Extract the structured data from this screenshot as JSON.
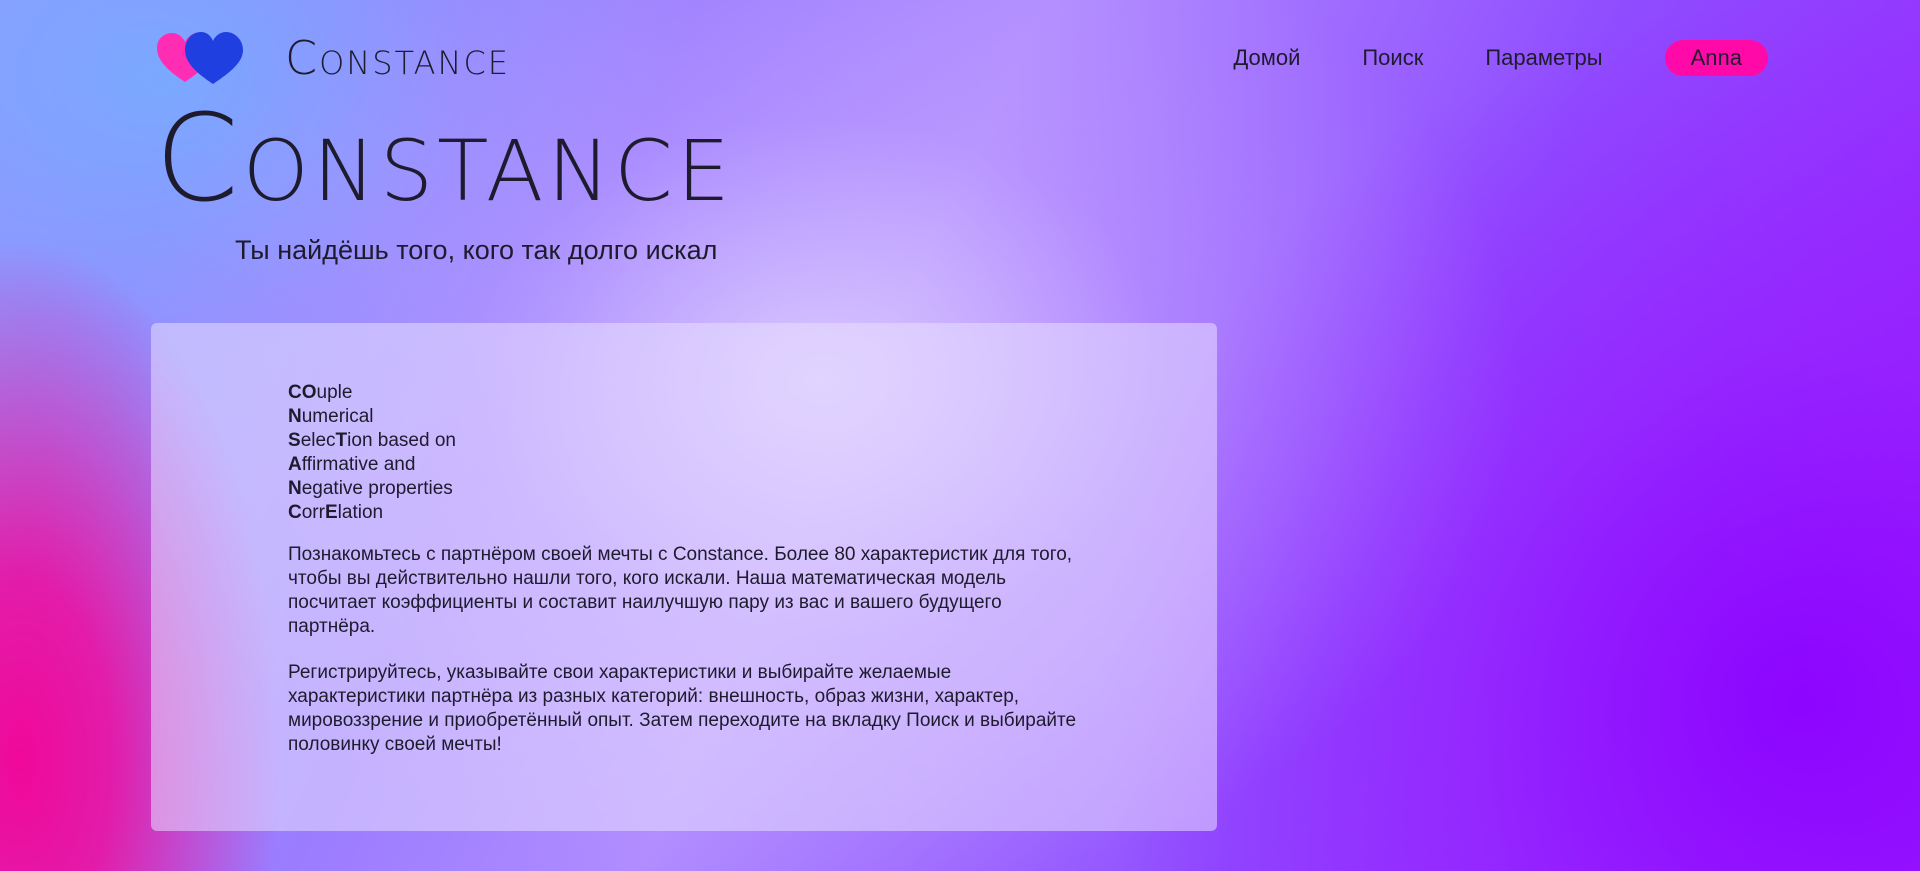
{
  "header": {
    "brand": "Constance",
    "nav": {
      "home": "Домой",
      "search": "Поиск",
      "settings": "Параметры",
      "user": "Anna"
    }
  },
  "hero": {
    "title": "Constance",
    "subtitle": "Ты найдёшь того, кого так долго искал"
  },
  "card": {
    "acronym": [
      {
        "bold": "CO",
        "rest": "uple"
      },
      {
        "bold": "N",
        "rest": "umerical"
      },
      {
        "bold": "S",
        "rest": "elec",
        "bold2": "T",
        "rest2": "ion based on"
      },
      {
        "bold": "A",
        "rest": "ffirmative and"
      },
      {
        "bold": "N",
        "rest": "egative properties"
      },
      {
        "bold": "C",
        "rest": "orr",
        "bold2": "E",
        "rest2": "lation"
      }
    ],
    "paragraph1": "Познакомьтесь с партнёром своей мечты с Constance. Более 80 характеристик для того, чтобы вы действительно нашли того, кого искали. Наша математическая модель посчитает коэффициенты и составит наилучшую пару из вас и вашего будущего партнёра.",
    "paragraph2": "Регистрируйтесь, указывайте свои характеристики и выбирайте желаемые характеристики партнёра из разных категорий: внешность, образ жизни, характер, мировоззрение и приобретённый опыт. Затем переходите на вкладку Поиск и выбирайте половинку своей мечты!"
  },
  "colors": {
    "accent_pink": "#ff0aa8",
    "heart_pink": "#ff2db4",
    "heart_blue": "#1f3fe0"
  },
  "icons": {
    "logo": "two-hearts-icon"
  }
}
